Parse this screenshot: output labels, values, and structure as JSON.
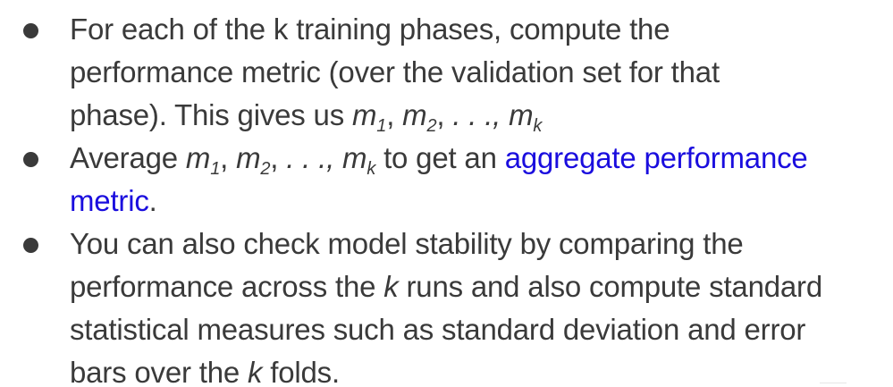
{
  "bullets": [
    {
      "text_line1": "For each of the k training phases, compute the",
      "text_line2": "performance metric (over the validation set for that",
      "text_line3_prefix": "phase).  This gives us ",
      "m": "m",
      "sub1": "1",
      "sub2": "2",
      "subk": "k",
      "comma": ", ",
      "ellipsis": ". . .,"
    },
    {
      "prefix": "Average ",
      "m": "m",
      "sub1": "1",
      "sub2": "2",
      "subk": "k",
      "comma": ", ",
      "ellipsis": ". . .,",
      "middle": " to get an ",
      "link_text_1": "aggregate performance",
      "link_text_2": "metric",
      "suffix": "."
    },
    {
      "line1": "You can also check model stability by comparing the",
      "line2_a": "performance across the ",
      "k": "k",
      "line2_b": " runs and also compute standard",
      "line3": "statistical measures such as standard deviation and error",
      "line4_a": "bars over the ",
      "line4_b": " folds."
    }
  ]
}
